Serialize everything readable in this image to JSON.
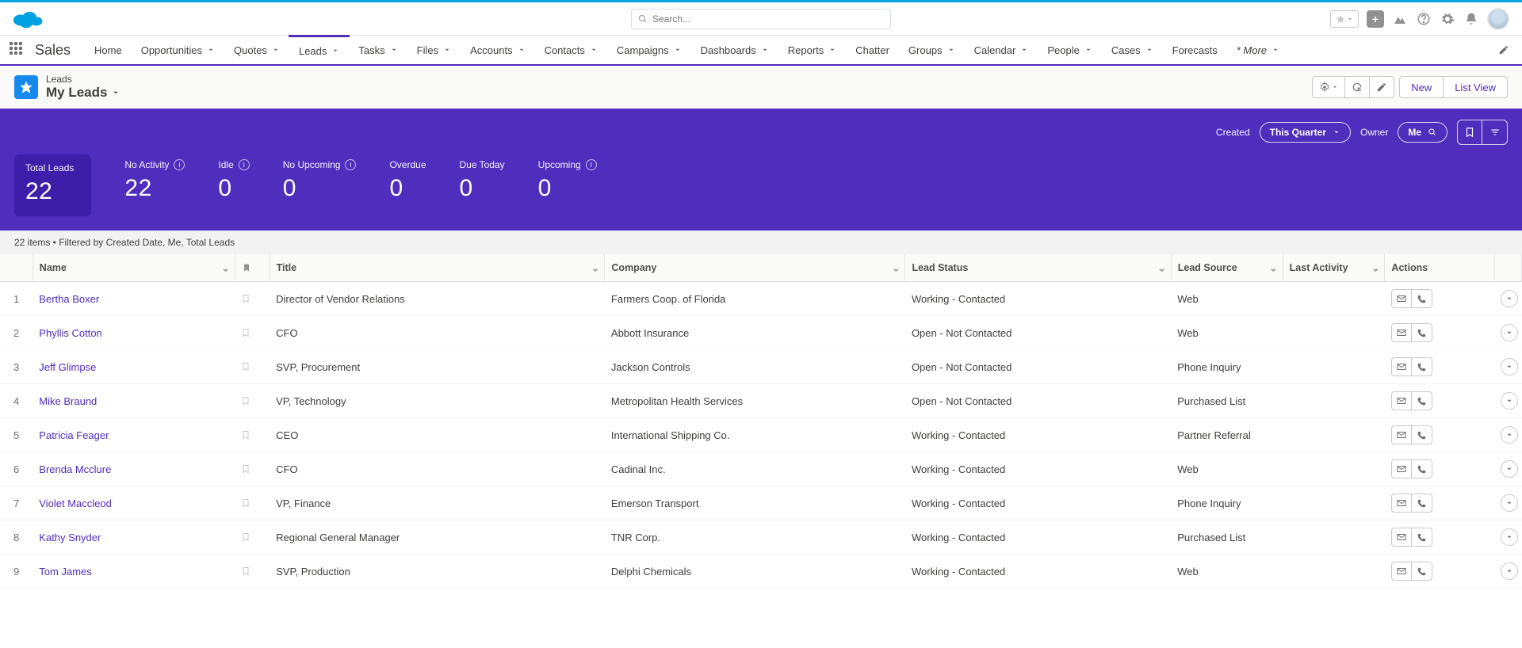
{
  "header": {
    "search_placeholder": "Search..."
  },
  "nav": {
    "app_name": "Sales",
    "items": [
      "Home",
      "Opportunities",
      "Quotes",
      "Leads",
      "Tasks",
      "Files",
      "Accounts",
      "Contacts",
      "Campaigns",
      "Dashboards",
      "Reports",
      "Chatter",
      "Groups",
      "Calendar",
      "People",
      "Cases",
      "Forecasts"
    ],
    "more_label": "* More",
    "active_index": 3
  },
  "page_header": {
    "object_label": "Leads",
    "view_name": "My Leads",
    "new_btn": "New",
    "list_view_btn": "List View"
  },
  "stats": {
    "created_label": "Created",
    "created_value": "This Quarter",
    "owner_label": "Owner",
    "owner_value": "Me",
    "metrics": [
      {
        "label": "Total Leads",
        "value": "22",
        "info": false,
        "primary": true
      },
      {
        "label": "No Activity",
        "value": "22",
        "info": true
      },
      {
        "label": "Idle",
        "value": "0",
        "info": true
      },
      {
        "label": "No Upcoming",
        "value": "0",
        "info": true
      },
      {
        "label": "Overdue",
        "value": "0",
        "info": false
      },
      {
        "label": "Due Today",
        "value": "0",
        "info": false
      },
      {
        "label": "Upcoming",
        "value": "0",
        "info": true
      }
    ]
  },
  "filter_summary": "22 items • Filtered by Created Date, Me, Total Leads",
  "table": {
    "columns": {
      "name": "Name",
      "title": "Title",
      "company": "Company",
      "status": "Lead Status",
      "source": "Lead Source",
      "activity": "Last Activity",
      "actions": "Actions"
    },
    "rows": [
      {
        "n": "1",
        "name": "Bertha Boxer",
        "title": "Director of Vendor Relations",
        "company": "Farmers Coop. of Florida",
        "status": "Working - Contacted",
        "source": "Web",
        "activity": ""
      },
      {
        "n": "2",
        "name": "Phyllis Cotton",
        "title": "CFO",
        "company": "Abbott Insurance",
        "status": "Open - Not Contacted",
        "source": "Web",
        "activity": ""
      },
      {
        "n": "3",
        "name": "Jeff Glimpse",
        "title": "SVP, Procurement",
        "company": "Jackson Controls",
        "status": "Open - Not Contacted",
        "source": "Phone Inquiry",
        "activity": ""
      },
      {
        "n": "4",
        "name": "Mike Braund",
        "title": "VP, Technology",
        "company": "Metropolitan Health Services",
        "status": "Open - Not Contacted",
        "source": "Purchased List",
        "activity": ""
      },
      {
        "n": "5",
        "name": "Patricia Feager",
        "title": "CEO",
        "company": "International Shipping Co.",
        "status": "Working - Contacted",
        "source": "Partner Referral",
        "activity": ""
      },
      {
        "n": "6",
        "name": "Brenda Mcclure",
        "title": "CFO",
        "company": "Cadinal Inc.",
        "status": "Working - Contacted",
        "source": "Web",
        "activity": ""
      },
      {
        "n": "7",
        "name": "Violet Maccleod",
        "title": "VP, Finance",
        "company": "Emerson Transport",
        "status": "Working - Contacted",
        "source": "Phone Inquiry",
        "activity": ""
      },
      {
        "n": "8",
        "name": "Kathy Snyder",
        "title": "Regional General Manager",
        "company": "TNR Corp.",
        "status": "Working - Contacted",
        "source": "Purchased List",
        "activity": ""
      },
      {
        "n": "9",
        "name": "Tom James",
        "title": "SVP, Production",
        "company": "Delphi Chemicals",
        "status": "Working - Contacted",
        "source": "Web",
        "activity": ""
      }
    ]
  }
}
